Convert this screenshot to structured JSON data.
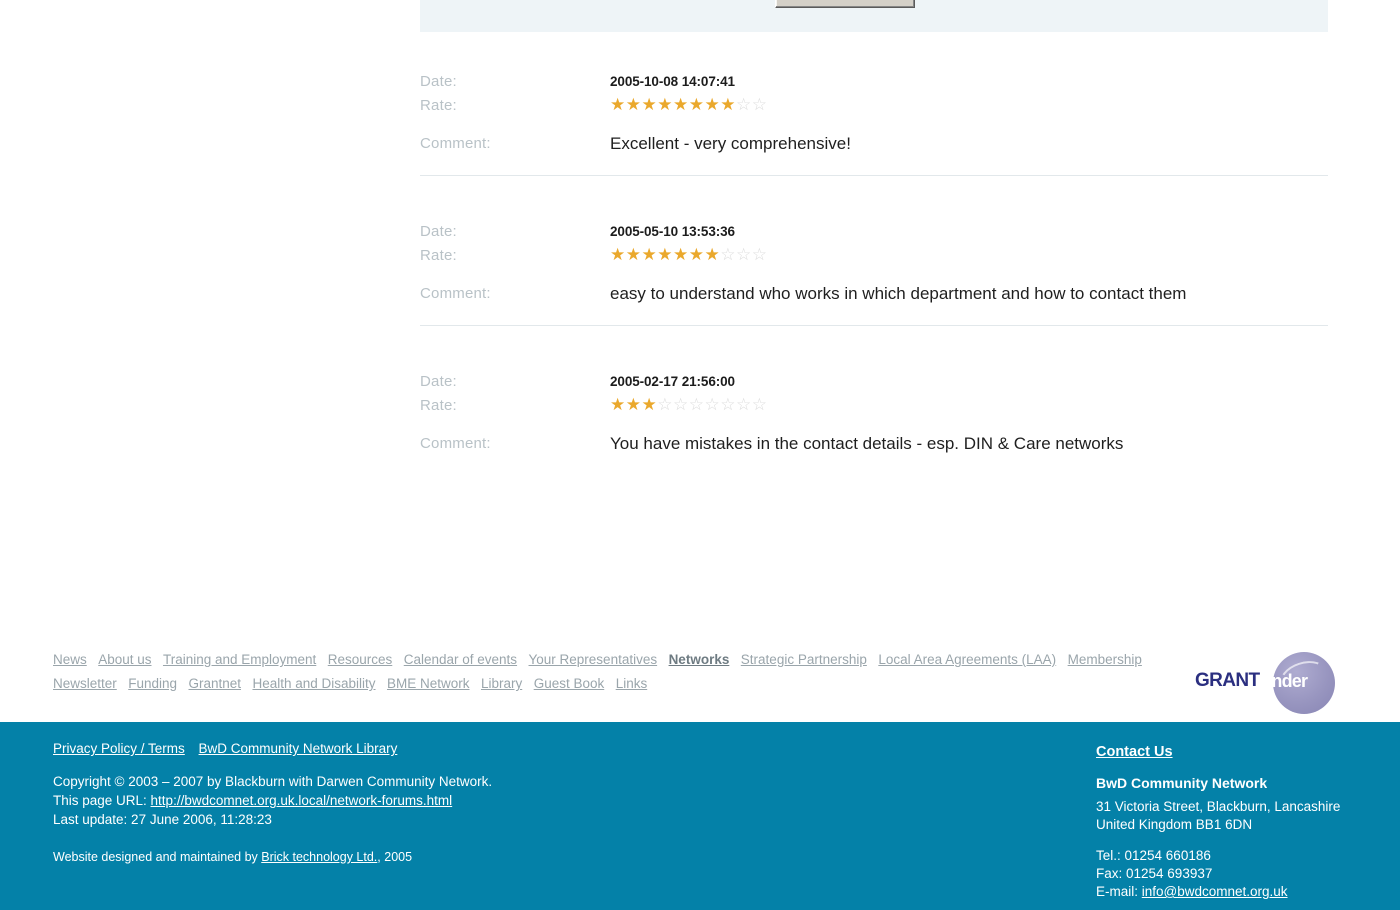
{
  "top_panel": {
    "button_label": ""
  },
  "reviews": {
    "labels": {
      "date": "Date:",
      "rate": "Rate:",
      "comment": "Comment:"
    },
    "max_stars": 10,
    "items": [
      {
        "date": "2005-10-08 14:07:41",
        "rating": 8,
        "comment": "Excellent - very comprehensive!"
      },
      {
        "date": "2005-05-10 13:53:36",
        "rating": 7,
        "comment": "easy to understand who works in which department and how to contact them"
      },
      {
        "date": "2005-02-17 21:56:00",
        "rating": 3,
        "comment": "You have mistakes in the contact details - esp. DIN & Care networks"
      }
    ]
  },
  "sitemap": {
    "links": [
      {
        "label": "News",
        "current": false
      },
      {
        "label": "About us",
        "current": false
      },
      {
        "label": "Training and Employment",
        "current": false
      },
      {
        "label": "Resources",
        "current": false
      },
      {
        "label": "Calendar of events",
        "current": false
      },
      {
        "label": "Your Representatives",
        "current": false
      },
      {
        "label": "Networks",
        "current": true
      },
      {
        "label": "Strategic Partnership",
        "current": false
      },
      {
        "label": "Local Area Agreements (LAA)",
        "current": false
      },
      {
        "label": "Membership",
        "current": false
      },
      {
        "label": "Newsletter",
        "current": false
      },
      {
        "label": "Funding",
        "current": false
      },
      {
        "label": "Grantnet",
        "current": false
      },
      {
        "label": "Health and Disability",
        "current": false
      },
      {
        "label": "BME Network",
        "current": false
      },
      {
        "label": "Library",
        "current": false
      },
      {
        "label": "Guest Book",
        "current": false
      },
      {
        "label": "Links",
        "current": false
      }
    ]
  },
  "grantfinder": {
    "text_primary": "GRANT",
    "text_secondary": "finder"
  },
  "footer": {
    "links": [
      {
        "label": "Privacy Policy / Terms"
      },
      {
        "label": "BwD Community Network Library"
      }
    ],
    "copyright": "Copyright © 2003 – 2007 by Blackburn with Darwen Community Network.",
    "page_url_label": "This page URL: ",
    "page_url": "http://bwdcomnet.org.uk.local/network-forums.html",
    "last_update": "Last update: 27 June 2006, 11:28:23",
    "credits_prefix": "Website designed and maintained by ",
    "credits_link": "Brick technology Ltd.",
    "credits_suffix": ", 2005",
    "contact_heading": "Contact Us",
    "org_name": "BwD Community Network",
    "address_line1": "31 Victoria Street, Blackburn, Lancashire",
    "address_line2": "United Kingdom BB1 6DN",
    "tel": "Tel.: 01254 660186",
    "fax": "Fax: 01254 693937",
    "email_label": "E-mail: ",
    "email": "info@bwdcomnet.org.uk"
  },
  "colors": {
    "teal": "#0481a8",
    "star_on": "#eaa82c",
    "star_off": "#dcdcdc",
    "label_gray": "#b9c2c7",
    "link_gray": "#9aa5ab",
    "panel_blue": "#eef4f7"
  }
}
